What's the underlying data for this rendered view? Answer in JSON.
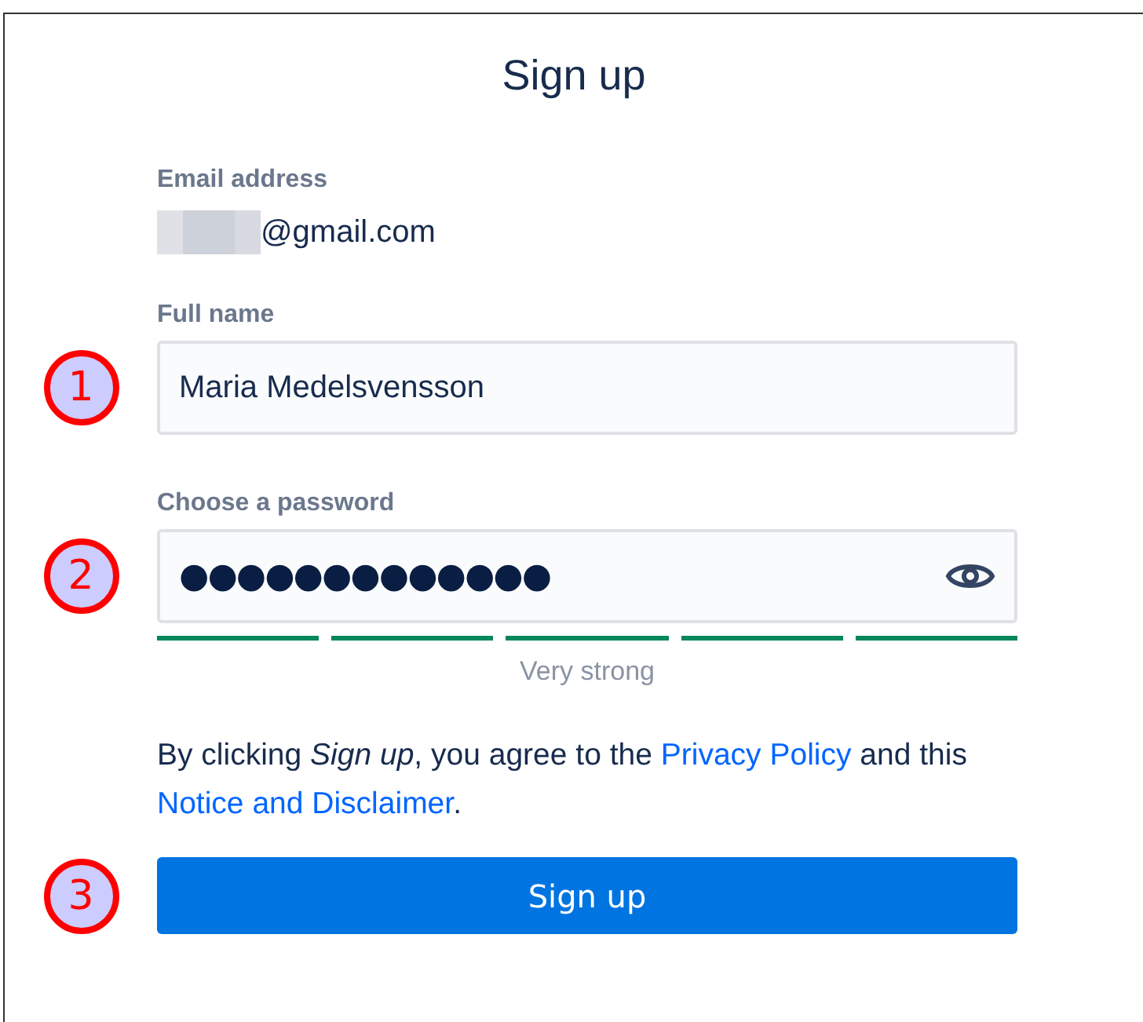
{
  "title": "Sign up",
  "email": {
    "label": "Email address",
    "redacted": true,
    "value": "@gmail.com"
  },
  "full_name": {
    "marker": "1",
    "label": "Full name",
    "value": "Maria Medelsvensson"
  },
  "password": {
    "marker": "2",
    "label": "Choose a password",
    "value": "●●●●●●●●●●●●●",
    "meter": [
      {
        "filled": true
      },
      {
        "filled": true
      },
      {
        "filled": true
      },
      {
        "filled": true
      },
      {
        "filled": true
      }
    ],
    "strength": "Very strong"
  },
  "consent": [
    {
      "kind": "text",
      "text": "By clicking *Sign up*, you agree to the "
    },
    {
      "kind": "link",
      "text": "Privacy Policy"
    },
    {
      "kind": "text",
      "text": " and this "
    },
    {
      "kind": "link",
      "text": "Notice and Disclaimer"
    },
    {
      "kind": "text",
      "text": "."
    }
  ],
  "submit": {
    "marker": "3",
    "label": "Sign up"
  }
}
